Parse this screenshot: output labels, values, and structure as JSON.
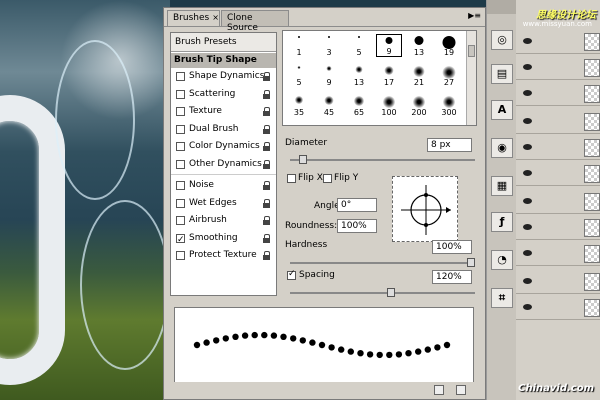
{
  "tabs": [
    {
      "label": "Brushes",
      "close": "×"
    },
    {
      "label": "Clone Source"
    }
  ],
  "panel_menu": "▶≡",
  "left": {
    "presets": "Brush Presets",
    "tip_shape": "Brush Tip Shape",
    "options": [
      {
        "label": "Shape Dynamics",
        "checked": false
      },
      {
        "label": "Scattering",
        "checked": false
      },
      {
        "label": "Texture",
        "checked": false
      },
      {
        "label": "Dual Brush",
        "checked": false
      },
      {
        "label": "Color Dynamics",
        "checked": false
      },
      {
        "label": "Other Dynamics",
        "checked": false
      },
      {
        "label": "Noise",
        "checked": false
      },
      {
        "label": "Wet Edges",
        "checked": false
      },
      {
        "label": "Airbrush",
        "checked": false
      },
      {
        "label": "Smoothing",
        "checked": true
      },
      {
        "label": "Protect Texture",
        "checked": false
      }
    ]
  },
  "brush_grid": [
    [
      "1",
      "3",
      "5",
      "9",
      "13",
      "19"
    ],
    [
      "5",
      "9",
      "13",
      "17",
      "21",
      "27"
    ],
    [
      "35",
      "45",
      "65",
      "100",
      "200",
      "300"
    ]
  ],
  "diameter": {
    "label": "Diameter",
    "value": "8 px",
    "level": 0.05
  },
  "flip_x": "Flip X",
  "flip_y": "Flip Y",
  "angle": {
    "label": "Angle:",
    "value": "0°"
  },
  "roundness": {
    "label": "Roundness:",
    "value": "100%"
  },
  "hardness": {
    "label": "Hardness",
    "value": "100%",
    "level": 1.0
  },
  "spacing": {
    "label": "Spacing",
    "value": "120%",
    "checked": true,
    "level": 0.55
  },
  "watermark": {
    "text": "思缘设计论坛",
    "sub": "www.missyuan.com"
  },
  "site": "Chinavid.com",
  "dock_labels": {
    "type": "A"
  }
}
